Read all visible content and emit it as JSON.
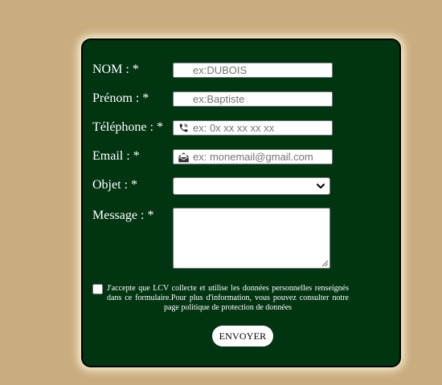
{
  "form": {
    "fields": {
      "nom": {
        "label": "NOM :",
        "required_mark": "*",
        "placeholder": "ex:DUBOIS",
        "value": ""
      },
      "prenom": {
        "label": "Prénom :",
        "required_mark": "*",
        "placeholder": "ex:Baptiste",
        "value": ""
      },
      "telephone": {
        "label": "Téléphone :",
        "required_mark": "*",
        "placeholder": "ex: 0x xx xx xx xx",
        "value": "",
        "icon": "phone-icon"
      },
      "email": {
        "label": "Email :",
        "required_mark": "*",
        "placeholder": "ex: monemail@gmail.com",
        "value": "",
        "icon": "envelope-icon"
      },
      "objet": {
        "label": "Objet :",
        "required_mark": "*",
        "selected": ""
      },
      "message": {
        "label": "Message :",
        "required_mark": "*",
        "value": ""
      }
    },
    "consent": {
      "checked": false,
      "text": "J'accepte que LCV collecte et utilise les données personnelles renseignés dans ce formulaire.Pour plus d'information, vous pouvez consulter notre page politique de protection de données"
    },
    "submit_label": "ENVOYER"
  },
  "colors": {
    "page_background": "#c9ad7f",
    "form_background": "#013512",
    "form_border": "#000000",
    "text": "#ffffff"
  }
}
